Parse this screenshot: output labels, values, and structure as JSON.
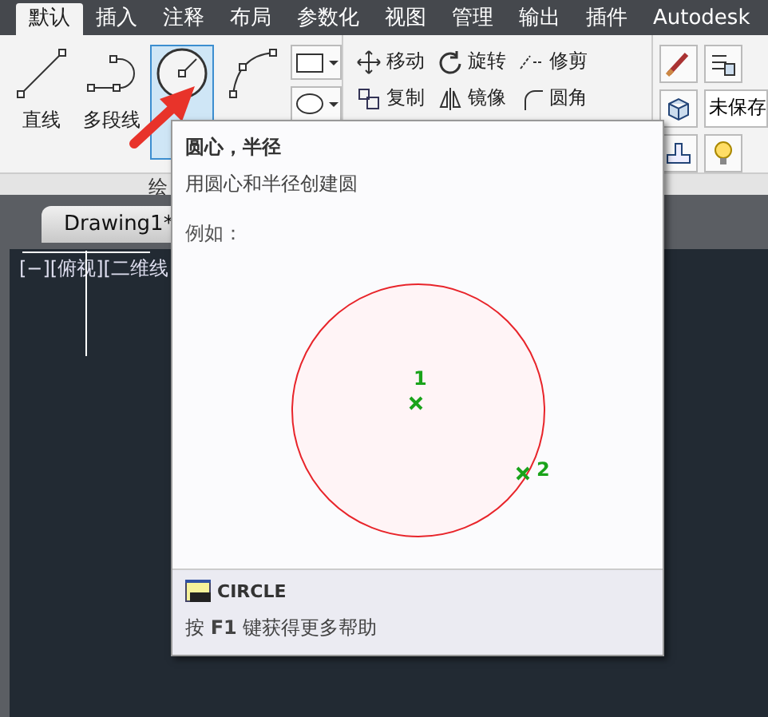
{
  "ribbon_tabs": [
    {
      "label": "默认",
      "selected": true
    },
    {
      "label": "插入",
      "selected": false
    },
    {
      "label": "注释",
      "selected": false
    },
    {
      "label": "布局",
      "selected": false
    },
    {
      "label": "参数化",
      "selected": false
    },
    {
      "label": "视图",
      "selected": false
    },
    {
      "label": "管理",
      "selected": false
    },
    {
      "label": "输出",
      "selected": false
    },
    {
      "label": "插件",
      "selected": false
    },
    {
      "label": "Autodesk",
      "selected": false
    }
  ],
  "draw_panel": {
    "title": "绘",
    "tools": [
      {
        "kind": "line",
        "label": "直线",
        "selected": false
      },
      {
        "kind": "polyline",
        "label": "多段线",
        "selected": false
      },
      {
        "kind": "circle",
        "selected": true
      },
      {
        "kind": "arc",
        "selected": false
      }
    ]
  },
  "modify_panel": {
    "rows": [
      [
        {
          "kind": "move",
          "label": "移动"
        },
        {
          "kind": "rotate",
          "label": "旋转"
        },
        {
          "kind": "trim",
          "label": "修剪"
        }
      ],
      [
        {
          "kind": "copy",
          "label": "复制"
        },
        {
          "kind": "mirror",
          "label": "镜像"
        },
        {
          "kind": "fillet",
          "label": "圆角"
        }
      ]
    ]
  },
  "layer_panel": {
    "label": "未保存"
  },
  "file_tabs": [
    {
      "label": "Drawing1*",
      "selected": true
    }
  ],
  "viewport_label": "[−][俯视][二维线",
  "tooltip": {
    "title": "圆心，半径",
    "description": "用圆心和半径创建圆",
    "example_label": "例如：",
    "points": [
      "1",
      "2"
    ],
    "command": "CIRCLE",
    "help": "按 **F1** 键获得更多帮助"
  }
}
